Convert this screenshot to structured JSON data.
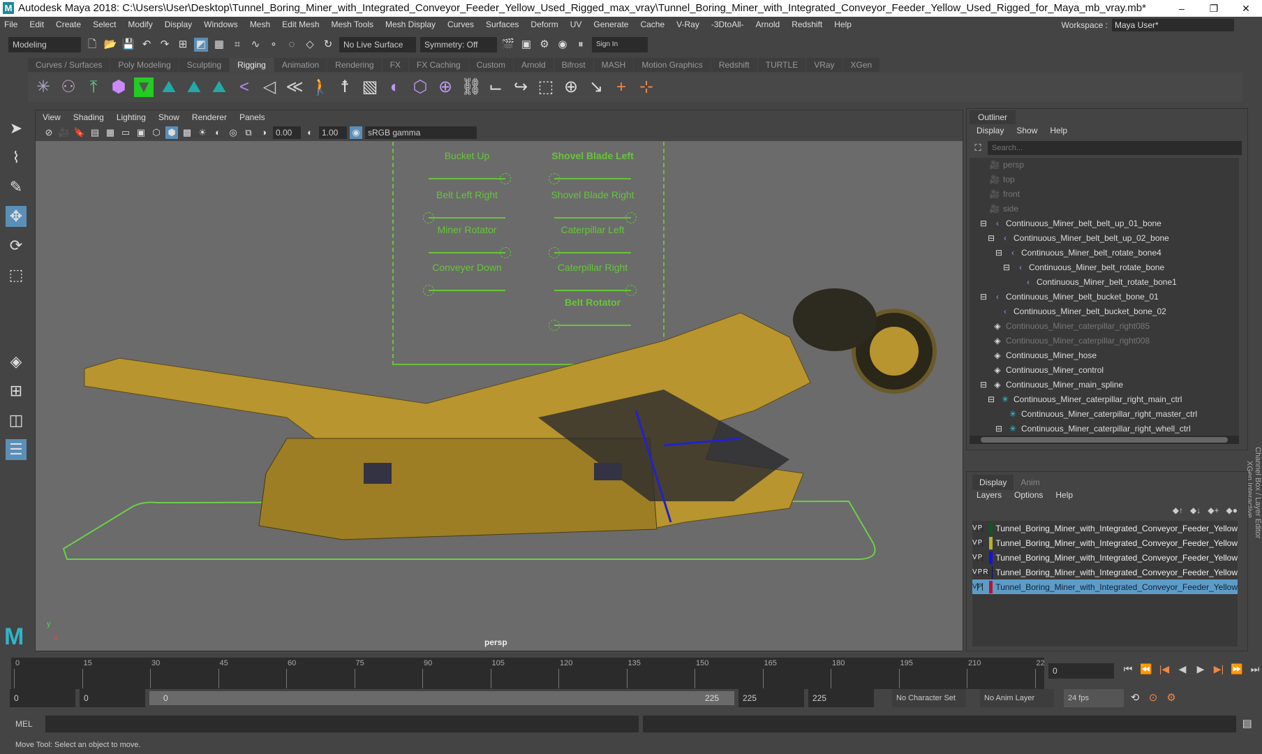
{
  "title": "Autodesk Maya 2018: C:\\Users\\User\\Desktop\\Tunnel_Boring_Miner_with_Integrated_Conveyor_Feeder_Yellow_Used_Rigged_max_vray\\Tunnel_Boring_Miner_with_Integrated_Conveyor_Feeder_Yellow_Used_Rigged_for_Maya_mb_vray.mb*",
  "menu": [
    "File",
    "Edit",
    "Create",
    "Select",
    "Modify",
    "Display",
    "Windows",
    "Mesh",
    "Edit Mesh",
    "Mesh Tools",
    "Mesh Display",
    "Curves",
    "Surfaces",
    "Deform",
    "UV",
    "Generate",
    "Cache",
    "V-Ray",
    "-3DtoAll-",
    "Arnold",
    "Redshift",
    "Help"
  ],
  "workspace": {
    "label": "Workspace :",
    "value": "Maya User*"
  },
  "status": {
    "mode": "Modeling",
    "live_surface": "No Live Surface",
    "symmetry": "Symmetry: Off",
    "sign_in": "Sign In"
  },
  "shelf_tabs": [
    "Curves / Surfaces",
    "Poly Modeling",
    "Sculpting",
    "Rigging",
    "Animation",
    "Rendering",
    "FX",
    "FX Caching",
    "Custom",
    "Arnold",
    "Bifrost",
    "MASH",
    "Motion Graphics",
    "Redshift",
    "TURTLE",
    "VRay",
    "XGen"
  ],
  "viewport": {
    "menu": [
      "View",
      "Shading",
      "Lighting",
      "Show",
      "Renderer",
      "Panels"
    ],
    "exposure": "0.00",
    "gamma_value": "1.00",
    "colorspace": "sRGB gamma",
    "camera": "persp",
    "axis_y": "y",
    "axis_x": "x"
  },
  "rig_controls": [
    {
      "label": "Bucket Up",
      "value": 1
    },
    {
      "label": "Shovel Blade Left",
      "value": 0
    },
    {
      "label": "Belt Left Right",
      "value": 0
    },
    {
      "label": "Shovel Blade Right",
      "value": 1
    },
    {
      "label": "Miner Rotator",
      "value": 1
    },
    {
      "label": "Caterpillar Left",
      "value": 0
    },
    {
      "label": "Conveyer Down",
      "value": 0
    },
    {
      "label": "Caterpillar Right",
      "value": 1
    },
    {
      "label": "Belt Rotator",
      "value": 0
    }
  ],
  "outliner": {
    "tab": "Outliner",
    "menu": [
      "Display",
      "Show",
      "Help"
    ],
    "search_placeholder": "Search...",
    "items": [
      "persp",
      "top",
      "front",
      "side",
      "Continuous_Miner_belt_belt_up_01_bone",
      "Continuous_Miner_belt_belt_up_02_bone",
      "Continuous_Miner_belt_rotate_bone4",
      "Continuous_Miner_belt_rotate_bone",
      "Continuous_Miner_belt_rotate_bone1",
      "Continuous_Miner_belt_bucket_bone_01",
      "Continuous_Miner_belt_bucket_bone_02",
      "Continuous_Miner_caterpillar_right085",
      "Continuous_Miner_caterpillar_right008",
      "Continuous_Miner_hose",
      "Continuous_Miner_control",
      "Continuous_Miner_main_spline",
      "Continuous_Miner_caterpillar_right_main_ctrl",
      "Continuous_Miner_caterpillar_right_master_ctrl",
      "Continuous_Miner_caterpillar_right_whell_ctrl"
    ]
  },
  "side_tabs": {
    "channel": "Channel Box / Layer Editor",
    "xgen": "XGen Interactive"
  },
  "layers": {
    "tabs": [
      "Display",
      "Anim"
    ],
    "menu": [
      "Layers",
      "Options",
      "Help"
    ],
    "rows": [
      {
        "v": "V",
        "p": "P",
        "r": "",
        "color": "#0a5a1e",
        "name": "Tunnel_Boring_Miner_with_Integrated_Conveyor_Feeder_Yellow"
      },
      {
        "v": "V",
        "p": "P",
        "r": "",
        "color": "#b8b030",
        "name": "Tunnel_Boring_Miner_with_Integrated_Conveyor_Feeder_Yellow"
      },
      {
        "v": "V",
        "p": "P",
        "r": "",
        "color": "#1010f0",
        "name": "Tunnel_Boring_Miner_with_Integrated_Conveyor_Feeder_Yellow"
      },
      {
        "v": "V",
        "p": "P",
        "r": "R",
        "color": "#0a0a70",
        "name": "Tunnel_Boring_Miner_with_Integrated_Conveyor_Feeder_Yellow"
      },
      {
        "v": "V",
        "p": "P",
        "r": "",
        "color": "#c01030",
        "name": "Tunnel_Boring_Miner_with_Integrated_Conveyor_Feeder_Yellow"
      }
    ]
  },
  "timeline": {
    "ticks": [
      "0",
      "15",
      "30",
      "45",
      "60",
      "75",
      "90",
      "105",
      "120",
      "135",
      "150",
      "165",
      "180",
      "195",
      "210",
      "22"
    ],
    "current": "0"
  },
  "range": {
    "start": "0",
    "anim_start": "0",
    "slider_start": "0",
    "slider_end": "225",
    "end": "225",
    "anim_end": "225",
    "character_set": "No Character Set",
    "anim_layer": "No Anim Layer",
    "fps": "24 fps"
  },
  "mel_label": "MEL",
  "help_line": "Move Tool: Select an object to move."
}
